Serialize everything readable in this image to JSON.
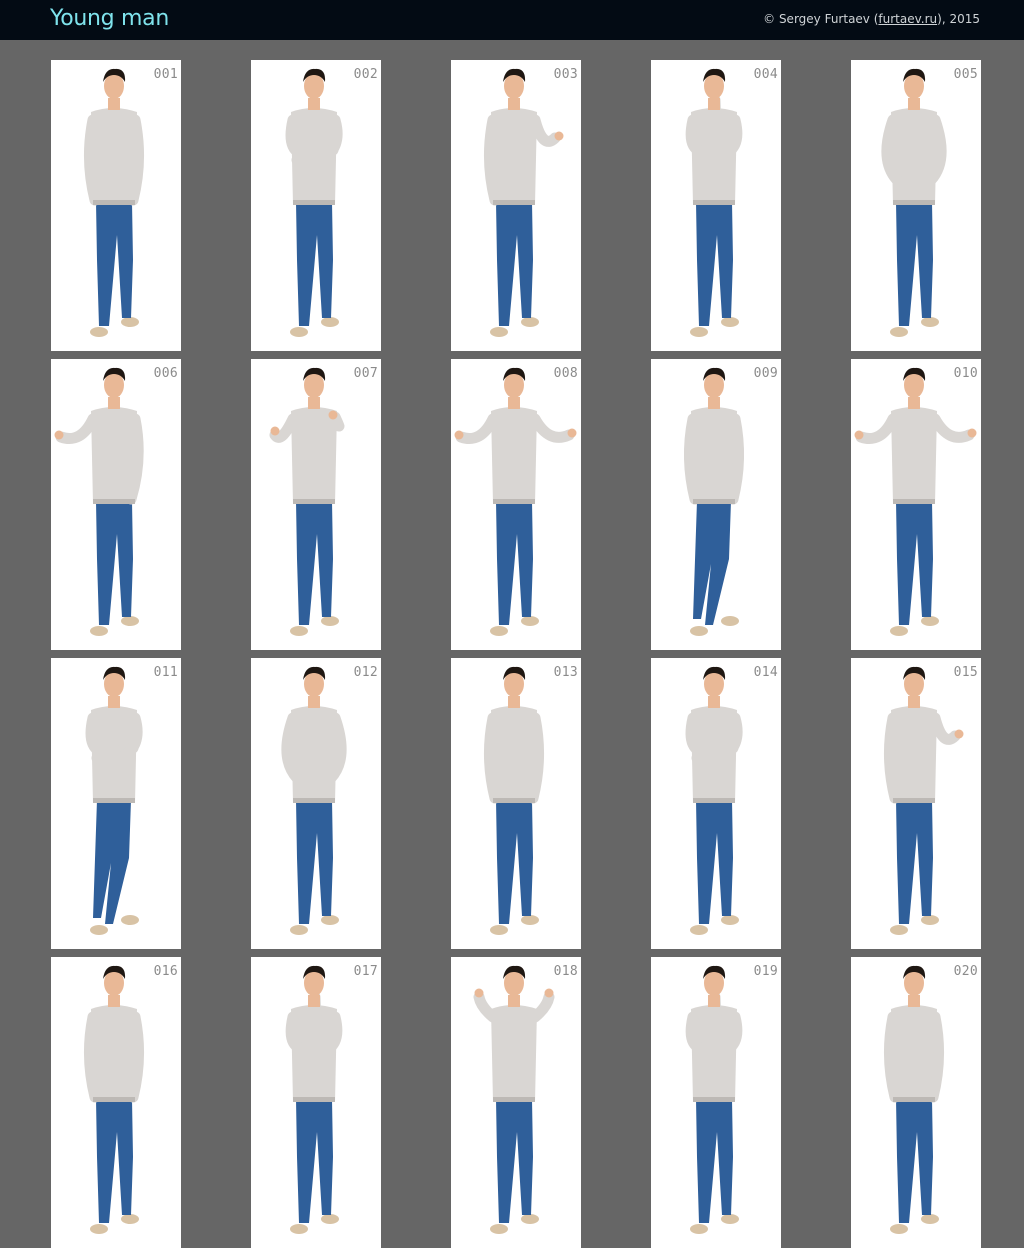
{
  "header": {
    "title": "Young man",
    "copyright_prefix": "© Sergey Furtaev (",
    "copyright_link": "furtaev.ru",
    "copyright_suffix": "), 2015",
    "bg_color": "#030b14",
    "title_color": "#7fe3ec"
  },
  "gallery": {
    "bg_color": "#666666",
    "items": [
      {
        "label": "001",
        "pose": "hands-in-pockets"
      },
      {
        "label": "002",
        "pose": "arms-crossed"
      },
      {
        "label": "003",
        "pose": "pointing-side"
      },
      {
        "label": "004",
        "pose": "thinking-hand-chin"
      },
      {
        "label": "005",
        "pose": "hands-on-hips"
      },
      {
        "label": "006",
        "pose": "presenting-left"
      },
      {
        "label": "007",
        "pose": "laughing-hand-up"
      },
      {
        "label": "008",
        "pose": "shrug-arms-open"
      },
      {
        "label": "009",
        "pose": "walking-hands-in-pockets"
      },
      {
        "label": "010",
        "pose": "shrug-arms-open"
      },
      {
        "label": "011",
        "pose": "arms-crossed-legs-crossed"
      },
      {
        "label": "012",
        "pose": "hands-on-hips"
      },
      {
        "label": "013",
        "pose": "hands-in-pockets"
      },
      {
        "label": "014",
        "pose": "arms-crossed"
      },
      {
        "label": "015",
        "pose": "pointing-side"
      },
      {
        "label": "016",
        "pose": "standing"
      },
      {
        "label": "017",
        "pose": "thinking-hand-chin"
      },
      {
        "label": "018",
        "pose": "thumbs-up"
      },
      {
        "label": "019",
        "pose": "thinking-hand-chin"
      },
      {
        "label": "020",
        "pose": "standing"
      }
    ]
  }
}
